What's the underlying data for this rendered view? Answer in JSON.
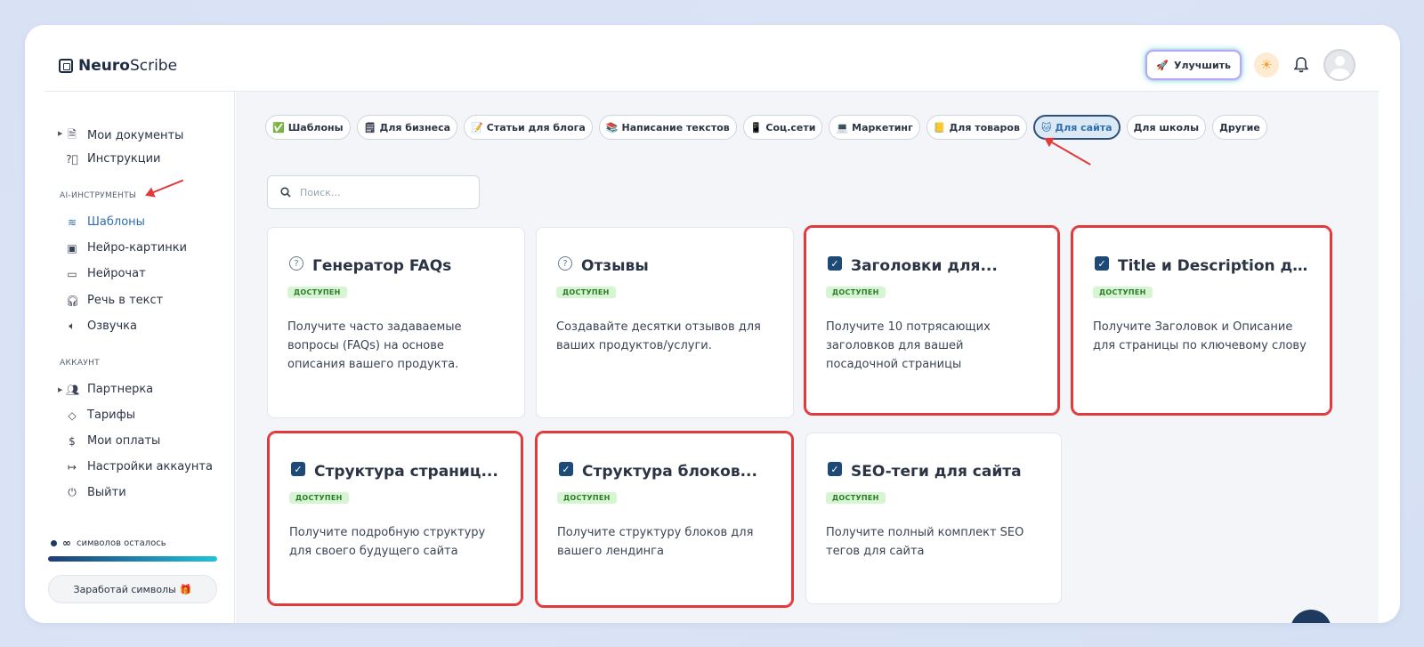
{
  "app": {
    "brand_bold": "Neuro",
    "brand_rest": "Scribe"
  },
  "header": {
    "upgrade_label": "Улучшить",
    "upgrade_icon": "rocket-icon",
    "theme_icon": "sun-icon",
    "bell_icon": "bell-icon"
  },
  "sidebar": {
    "top_items": [
      {
        "label": "Мои документы",
        "icon": "document-icon"
      },
      {
        "label": "Инструкции",
        "icon": "help-circle-icon"
      }
    ],
    "section_ai": "AI-ИНСТРУМЕНТЫ",
    "ai_items": [
      {
        "label": "Шаблоны",
        "icon": "layers-icon"
      },
      {
        "label": "Нейро-картинки",
        "icon": "image-icon"
      },
      {
        "label": "Нейрочат",
        "icon": "chat-icon"
      },
      {
        "label": "Речь в текст",
        "icon": "headphones-icon"
      },
      {
        "label": "Озвучка",
        "icon": "speaker-icon"
      }
    ],
    "section_account": "АККАУНТ",
    "account_items": [
      {
        "label": "Партнерка",
        "icon": "users-icon"
      },
      {
        "label": "Тарифы",
        "icon": "tag-icon"
      },
      {
        "label": "Мои оплаты",
        "icon": "dollar-icon"
      },
      {
        "label": "Настройки аккаунта",
        "icon": "logout-arrow-icon"
      },
      {
        "label": "Выйти",
        "icon": "power-icon"
      }
    ],
    "symbols_value": "∞",
    "symbols_label": "символов осталось",
    "earn_label": "Заработай символы",
    "earn_icon": "gift-icon"
  },
  "chips": [
    {
      "emoji": "✅",
      "label": "Шаблоны"
    },
    {
      "emoji": "🗒",
      "label": "Для бизнеса"
    },
    {
      "emoji": "📝",
      "label": "Статьи для блога"
    },
    {
      "emoji": "📚",
      "label": "Написание текстов"
    },
    {
      "emoji": "📱",
      "label": "Соц.сети"
    },
    {
      "emoji": "💻",
      "label": "Маркетинг"
    },
    {
      "emoji": "📒",
      "label": "Для товаров"
    },
    {
      "emoji": "🐱",
      "label": "Для сайта"
    },
    {
      "emoji": "",
      "label": "Для школы"
    },
    {
      "emoji": "",
      "label": "Другие"
    }
  ],
  "active_chip": "Для сайта",
  "search": {
    "placeholder": "Поиск..."
  },
  "cards": [
    {
      "title": "Генератор FAQs",
      "badge": "ДОСТУПЕН",
      "desc": "Получите часто задаваемые вопросы (FAQs) на основе описания вашего продукта.",
      "icon": "question-icon",
      "highlighted": false
    },
    {
      "title": "Отзывы",
      "badge": "ДОСТУПЕН",
      "desc": "Создавайте десятки отзывов для ваших продуктов/услуги.",
      "icon": "question-icon",
      "highlighted": false
    },
    {
      "title": "Заголовки для...",
      "badge": "ДОСТУПЕН",
      "desc": "Получите 10 потрясающих заголовков для вашей посадочной страницы",
      "icon": "checkbox-icon",
      "highlighted": true
    },
    {
      "title": "Title и Description для...",
      "badge": "ДОСТУПЕН",
      "desc": "Получите Заголовок и Описание для страницы по ключевому слову",
      "icon": "checkbox-icon",
      "highlighted": true
    },
    {
      "title": "Структура страниц...",
      "badge": "ДОСТУПЕН",
      "desc": "Получите подробную структуру для своего будущего сайта",
      "icon": "checkbox-icon",
      "highlighted": true
    },
    {
      "title": "Структура блоков...",
      "badge": "ДОСТУПЕН",
      "desc": "Получите структуру блоков для вашего лендинга",
      "icon": "checkbox-icon",
      "highlighted": true
    },
    {
      "title": "SEO-теги для сайта",
      "badge": "ДОСТУПЕН",
      "desc": "Получите полный комплект SEO тегов для сайта",
      "icon": "checkbox-icon",
      "highlighted": false
    }
  ],
  "colors": {
    "accent": "#2d6fb0",
    "highlight": "#e03a3a",
    "badge_bg": "#d7f5d2"
  }
}
